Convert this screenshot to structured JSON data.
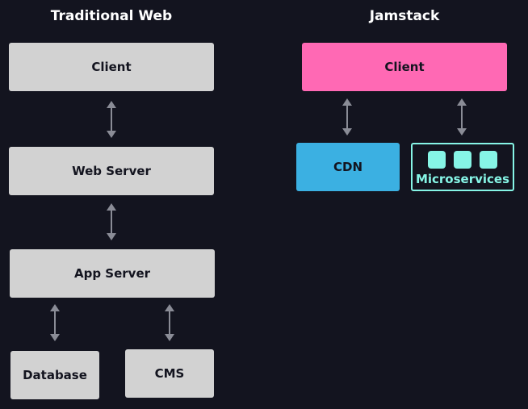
{
  "left": {
    "title": "Traditional Web",
    "client": "Client",
    "web_server": "Web Server",
    "app_server": "App Server",
    "database": "Database",
    "cms": "CMS"
  },
  "right": {
    "title": "Jamstack",
    "client": "Client",
    "cdn": "CDN",
    "microservices": "Microservices"
  },
  "colors": {
    "background": "#13141f",
    "box_gray": "#d2d2d2",
    "client_pink": "#ff69b4",
    "cdn_blue": "#3bb0e2",
    "microservices_cyan": "#86f5e6",
    "arrow": "#8a8c96"
  }
}
